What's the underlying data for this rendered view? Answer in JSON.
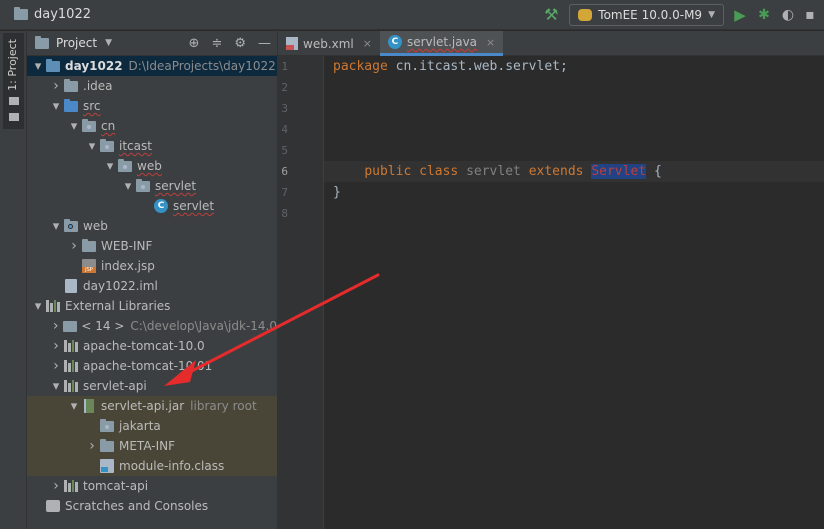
{
  "window": {
    "project_name": "day1022"
  },
  "toolbar": {
    "run_config": "TomEE 10.0.0-M9",
    "build_icon": "hammer-icon",
    "run_icon": "play-icon",
    "debug_icon": "bug-icon",
    "coverage_icon": "coverage-icon"
  },
  "tool_strip": {
    "project_tab": "1: Project"
  },
  "project_panel": {
    "title": "Project",
    "tree": [
      {
        "label": "day1022",
        "sub": "D:\\IdeaProjects\\day1022",
        "indent": 0,
        "arrow": "down",
        "icon": "module-folder",
        "bold": true,
        "selected": true
      },
      {
        "label": ".idea",
        "indent": 1,
        "arrow": "right",
        "icon": "folder"
      },
      {
        "label": "src",
        "indent": 1,
        "arrow": "down",
        "icon": "source-folder",
        "wavy": true
      },
      {
        "label": "cn",
        "indent": 2,
        "arrow": "down",
        "icon": "package",
        "wavy": true
      },
      {
        "label": "itcast",
        "indent": 3,
        "arrow": "down",
        "icon": "package",
        "wavy": true
      },
      {
        "label": "web",
        "indent": 4,
        "arrow": "down",
        "icon": "package",
        "wavy": true
      },
      {
        "label": "servlet",
        "indent": 5,
        "arrow": "down",
        "icon": "package",
        "wavy": true
      },
      {
        "label": "servlet",
        "indent": 6,
        "arrow": "none",
        "icon": "class",
        "wavy": true
      },
      {
        "label": "web",
        "indent": 1,
        "arrow": "down",
        "icon": "web-folder"
      },
      {
        "label": "WEB-INF",
        "indent": 2,
        "arrow": "right",
        "icon": "folder"
      },
      {
        "label": "index.jsp",
        "indent": 2,
        "arrow": "none",
        "icon": "jsp"
      },
      {
        "label": "day1022.iml",
        "indent": 1,
        "arrow": "none",
        "icon": "iml"
      },
      {
        "label": "External Libraries",
        "indent": 0,
        "arrow": "down",
        "icon": "libraries"
      },
      {
        "label": "< 14 >",
        "sub": "C:\\develop\\Java\\jdk-14.0",
        "indent": 1,
        "arrow": "right",
        "icon": "jdk"
      },
      {
        "label": "apache-tomcat-10.0",
        "indent": 1,
        "arrow": "right",
        "icon": "libraries"
      },
      {
        "label": "apache-tomcat-10.01",
        "indent": 1,
        "arrow": "right",
        "icon": "libraries"
      },
      {
        "label": "servlet-api",
        "indent": 1,
        "arrow": "down",
        "icon": "libraries"
      },
      {
        "label": "servlet-api.jar",
        "sub": "library root",
        "indent": 2,
        "arrow": "down",
        "icon": "jar",
        "lib": true
      },
      {
        "label": "jakarta",
        "indent": 3,
        "arrow": "none",
        "icon": "package",
        "lib": true
      },
      {
        "label": "META-INF",
        "indent": 3,
        "arrow": "right",
        "icon": "folder",
        "lib": true
      },
      {
        "label": "module-info.class",
        "indent": 3,
        "arrow": "none",
        "icon": "class-file",
        "lib": true
      },
      {
        "label": "tomcat-api",
        "indent": 1,
        "arrow": "right",
        "icon": "libraries"
      },
      {
        "label": "Scratches and Consoles",
        "indent": 0,
        "arrow": "none",
        "icon": "scratches"
      }
    ]
  },
  "editor": {
    "tabs": [
      {
        "label": "web.xml",
        "icon": "xml-file-icon",
        "active": false
      },
      {
        "label": "servlet.java",
        "icon": "class-icon",
        "active": true
      }
    ],
    "current_line": 6,
    "line_numbers": [
      "1",
      "2",
      "3",
      "4",
      "5",
      "6",
      "7",
      "8"
    ],
    "code": {
      "line1_keyword": "package",
      "line1_rest": " cn.itcast.web.servlet;",
      "line6_indent": "    ",
      "line6_public": "public",
      "line6_class": "class",
      "line6_name": "servlet",
      "line6_extends": "extends",
      "line6_super": "Servlet",
      "line6_brace": " {",
      "line7": "}"
    }
  },
  "annotation": {
    "color": "#e52b2b",
    "icon": "red-arrow-annotation"
  }
}
